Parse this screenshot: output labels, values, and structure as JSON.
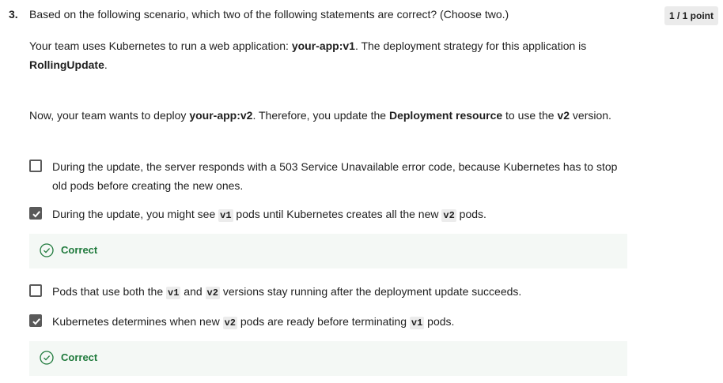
{
  "question": {
    "number": "3.",
    "text": "Based on the following scenario, which two of the following statements are correct? (Choose two.)",
    "points": "1 / 1 point"
  },
  "scenario": {
    "p1": {
      "a": "Your team uses Kubernetes to run a web application: ",
      "b1": "your-app:v1",
      "c": ". The deployment strategy for this application is ",
      "b2": "RollingUpdate",
      "d": "."
    },
    "p2": {
      "a": "Now, your team wants to deploy ",
      "b1": "your-app:v2",
      "c": ". Therefore, you update the ",
      "b2": "Deployment resource",
      "d": " to use the ",
      "b3": "v2",
      "e": " version."
    }
  },
  "options": [
    {
      "checked": false,
      "t1": "During the update, the server responds with a 503 Service Unavailable error code, because Kubernetes has to stop old pods before creating the new ones."
    },
    {
      "checked": true,
      "t1": "During the update, you might see ",
      "c1": "v1",
      "t2": " pods until Kubernetes creates all the new ",
      "c2": "v2",
      "t3": " pods.",
      "feedback": "Correct"
    },
    {
      "checked": false,
      "t1": "Pods that use both the ",
      "c1": "v1",
      "t2": " and ",
      "c2": "v2",
      "t3": " versions stay running after the deployment update succeeds."
    },
    {
      "checked": true,
      "t1": "Kubernetes determines when new ",
      "c1": "v2",
      "t2": " pods are ready before terminating ",
      "c2": "v1",
      "t3": " pods.",
      "feedback": "Correct"
    }
  ],
  "colors": {
    "checkbox": "#5a5a5a",
    "feedback_bg": "#f4f8f5",
    "feedback_text": "#1f7a3c"
  },
  "icons": {
    "checked": "checkmark-icon",
    "correct": "check-circle-icon"
  }
}
